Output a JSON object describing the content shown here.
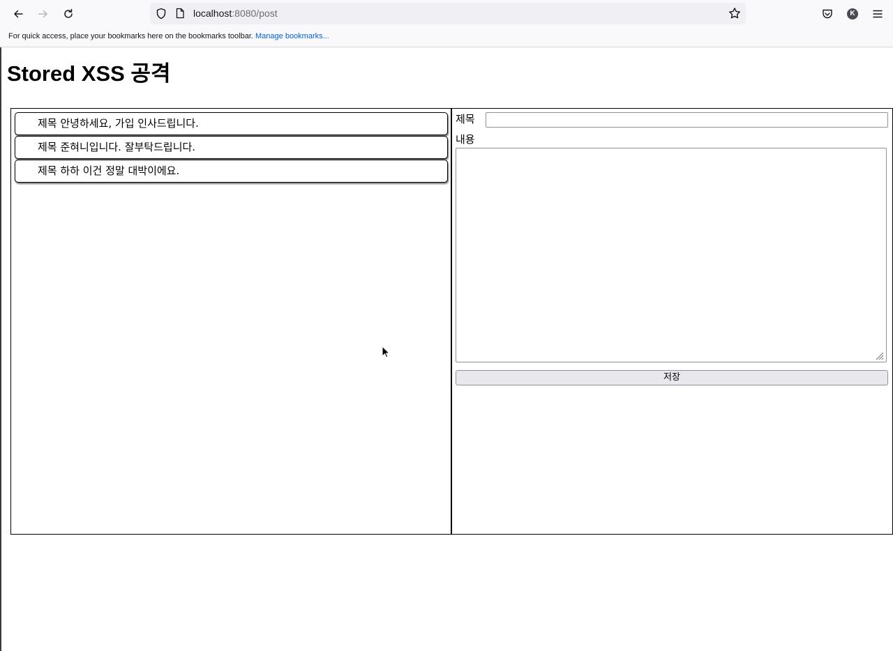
{
  "browser": {
    "url_host": "localhost",
    "url_rest": ":8080/post",
    "profile_initial": "K",
    "bookmarks_message": "For quick access, place your bookmarks here on the bookmarks toolbar.",
    "manage_bookmarks": "Manage bookmarks..."
  },
  "page": {
    "title": "Stored XSS 공격",
    "posts": [
      {
        "label": "제목 안녕하세요, 가입 인사드립니다."
      },
      {
        "label": "제목 준혀니입니다. 잘부탁드립니다."
      },
      {
        "label": "제목 하하 이건 정말 대박이에요."
      }
    ],
    "form": {
      "title_label": "제목",
      "title_value": "",
      "content_label": "내용",
      "content_value": "",
      "save_label": "저장"
    }
  },
  "colors": {
    "chrome_bg": "#f9f9fb",
    "urlbar_bg": "#f0f0f4",
    "link": "#0061e0",
    "button_bg": "#e9e9ed"
  }
}
